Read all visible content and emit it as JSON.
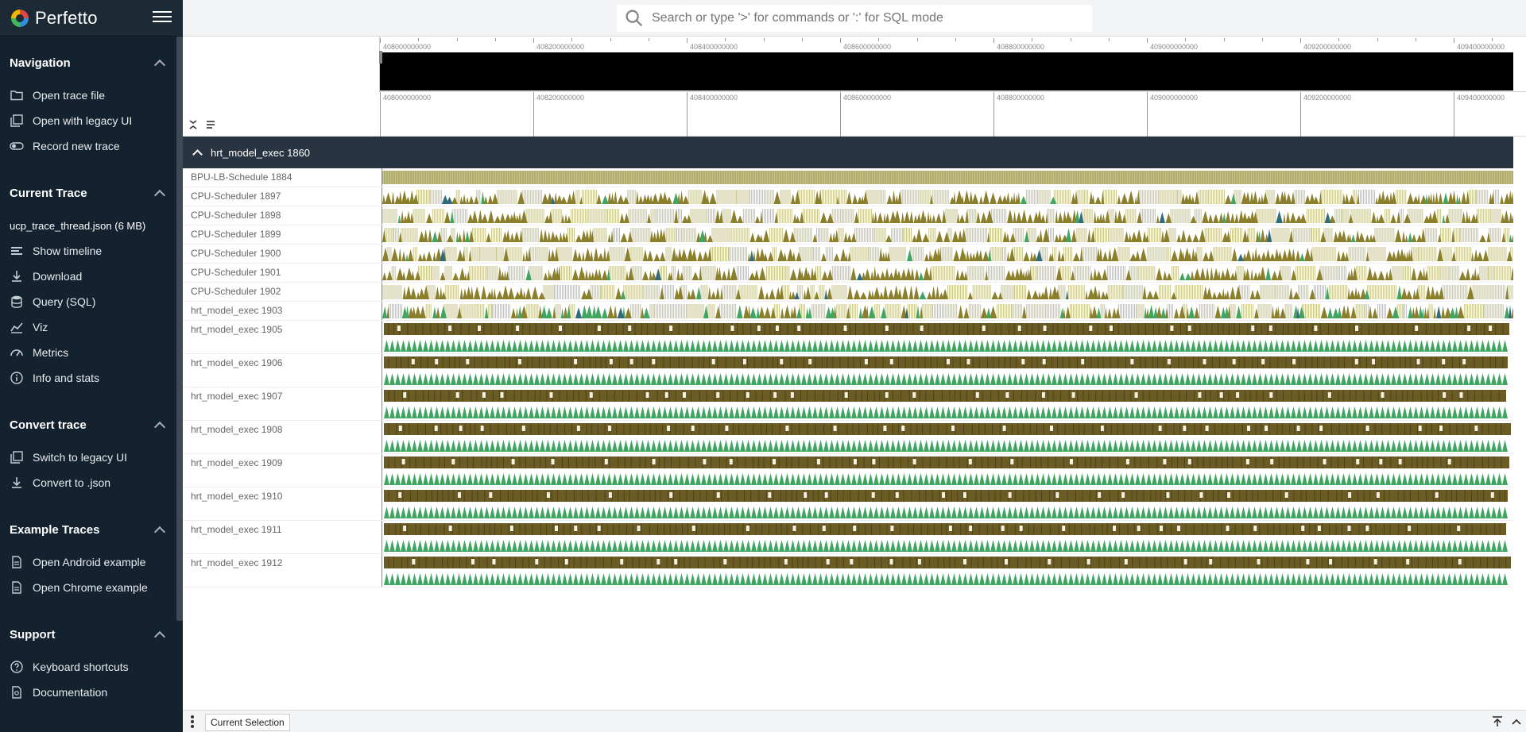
{
  "app": {
    "name": "Perfetto"
  },
  "search": {
    "placeholder": "Search or type '>' for commands or ':' for SQL mode"
  },
  "sidebar": {
    "sections": [
      {
        "title": "Navigation",
        "items": [
          {
            "label": "Open trace file",
            "icon": "folder-open-icon"
          },
          {
            "label": "Open with legacy UI",
            "icon": "filter-none-icon"
          },
          {
            "label": "Record new trace",
            "icon": "toggle-icon"
          }
        ]
      },
      {
        "title": "Current Trace",
        "trace": "ucp_trace_thread.json (6 MB)",
        "items": [
          {
            "label": "Show timeline",
            "icon": "timeline-icon"
          },
          {
            "label": "Download",
            "icon": "download-icon"
          },
          {
            "label": "Query (SQL)",
            "icon": "database-icon"
          },
          {
            "label": "Viz",
            "icon": "chart-icon"
          },
          {
            "label": "Metrics",
            "icon": "speed-icon"
          },
          {
            "label": "Info and stats",
            "icon": "info-icon"
          }
        ]
      },
      {
        "title": "Convert trace",
        "items": [
          {
            "label": "Switch to legacy UI",
            "icon": "filter-none-icon"
          },
          {
            "label": "Convert to .json",
            "icon": "download-icon"
          }
        ]
      },
      {
        "title": "Example Traces",
        "items": [
          {
            "label": "Open Android example",
            "icon": "description-icon"
          },
          {
            "label": "Open Chrome example",
            "icon": "description-icon"
          }
        ]
      },
      {
        "title": "Support",
        "items": [
          {
            "label": "Keyboard shortcuts",
            "icon": "help-icon"
          },
          {
            "label": "Documentation",
            "icon": "doc-search-icon"
          }
        ]
      }
    ]
  },
  "timeline": {
    "ticks": [
      "408000000000",
      "408200000000",
      "408400000000",
      "408600000000",
      "408800000000",
      "409000000000",
      "409200000000",
      "409400000000"
    ]
  },
  "group": {
    "title": "hrt_model_exec 1860"
  },
  "tracks": [
    {
      "name": "BPU-LB-Schedule 1884",
      "kind": "dense"
    },
    {
      "name": "CPU-Scheduler 1897",
      "kind": "mountains"
    },
    {
      "name": "CPU-Scheduler 1898",
      "kind": "mountains"
    },
    {
      "name": "CPU-Scheduler 1899",
      "kind": "mountains"
    },
    {
      "name": "CPU-Scheduler 1900",
      "kind": "mountains"
    },
    {
      "name": "CPU-Scheduler 1901",
      "kind": "mountains"
    },
    {
      "name": "CPU-Scheduler 1902",
      "kind": "mountains"
    },
    {
      "name": "hrt_model_exec 1903",
      "kind": "mixed"
    },
    {
      "name": "hrt_model_exec 1905",
      "kind": "slices"
    },
    {
      "name": "hrt_model_exec 1906",
      "kind": "slices"
    },
    {
      "name": "hrt_model_exec 1907",
      "kind": "slices"
    },
    {
      "name": "hrt_model_exec 1908",
      "kind": "slices"
    },
    {
      "name": "hrt_model_exec 1909",
      "kind": "slices"
    },
    {
      "name": "hrt_model_exec 1910",
      "kind": "slices"
    },
    {
      "name": "hrt_model_exec 1911",
      "kind": "slices"
    },
    {
      "name": "hrt_model_exec 1912",
      "kind": "slices"
    }
  ],
  "bottom": {
    "tab_label": "Current Selection"
  },
  "colors": {
    "olive": "#8c7f2b",
    "dark_olive": "#6b5c25",
    "green": "#3fa561",
    "teal": "#2f6b7a",
    "sidebar": "#13222e",
    "group_header": "#283441"
  }
}
